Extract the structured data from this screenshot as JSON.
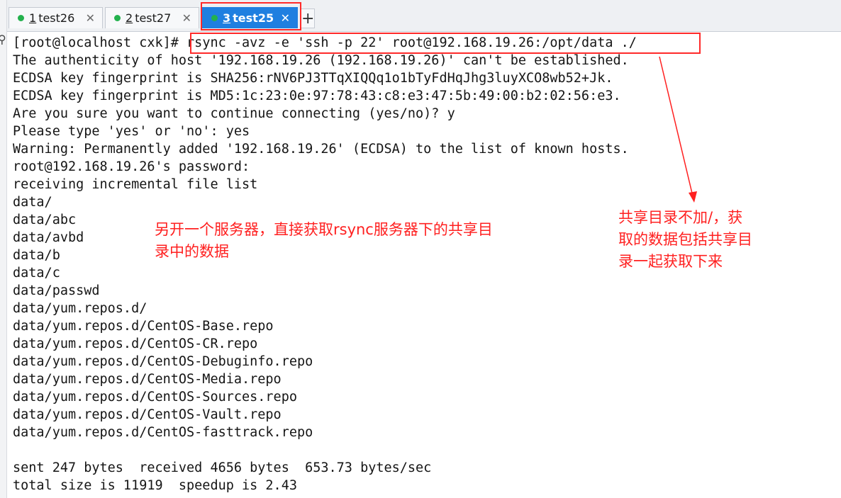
{
  "tabs": [
    {
      "num": "1",
      "label": "test26",
      "close": "✕"
    },
    {
      "num": "2",
      "label": "test27",
      "close": "✕"
    },
    {
      "num": "3",
      "label": "test25",
      "close": "✕"
    }
  ],
  "add_tab": "+",
  "terminal": {
    "prompt": "[root@localhost cxk]# ",
    "command": "rsync -avz -e 'ssh -p 22' root@192.168.19.26:/opt/data ./",
    "output": [
      "The authenticity of host '192.168.19.26 (192.168.19.26)' can't be established.",
      "ECDSA key fingerprint is SHA256:rNV6PJ3TTqXIQQq1o1bTyFdHqJhg3luyXCO8wb52+Jk.",
      "ECDSA key fingerprint is MD5:1c:23:0e:97:78:43:c8:e3:47:5b:49:00:b2:02:56:e3.",
      "Are you sure you want to continue connecting (yes/no)? y",
      "Please type 'yes' or 'no': yes",
      "Warning: Permanently added '192.168.19.26' (ECDSA) to the list of known hosts.",
      "root@192.168.19.26's password:",
      "receiving incremental file list",
      "data/",
      "data/abc",
      "data/avbd",
      "data/b",
      "data/c",
      "data/passwd",
      "data/yum.repos.d/",
      "data/yum.repos.d/CentOS-Base.repo",
      "data/yum.repos.d/CentOS-CR.repo",
      "data/yum.repos.d/CentOS-Debuginfo.repo",
      "data/yum.repos.d/CentOS-Media.repo",
      "data/yum.repos.d/CentOS-Sources.repo",
      "data/yum.repos.d/CentOS-Vault.repo",
      "data/yum.repos.d/CentOS-fasttrack.repo",
      "",
      "sent 247 bytes  received 4656 bytes  653.73 bytes/sec",
      "total size is 11919  speedup is 2.43"
    ]
  },
  "annotations": {
    "left_note": [
      "另开一个服务器，直接获取rsync服务器下的共享目",
      "录中的数据"
    ],
    "right_note": [
      "共享目录不加/，获",
      "取的数据包括共享目",
      "录一起获取下来"
    ],
    "color": "#ff2020"
  }
}
